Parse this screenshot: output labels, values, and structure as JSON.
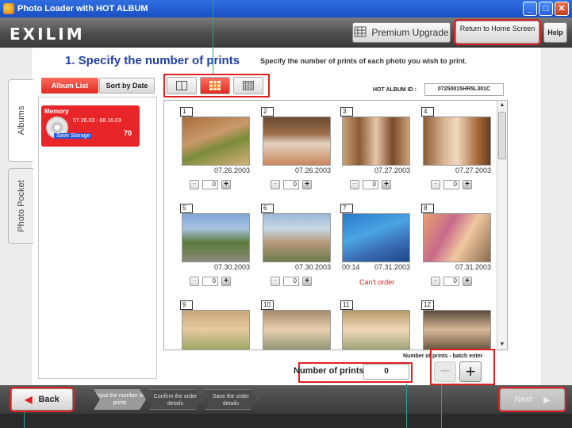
{
  "window": {
    "title": "Photo Loader with HOT ALBUM"
  },
  "header": {
    "logo": "EXILIM",
    "premium_label": "Premium Upgrade",
    "return_label": "Return to Home Screen",
    "help_label": "Help"
  },
  "step": {
    "title": "1. Specify the number of prints",
    "description": "Specify the number of prints of each photo you wish to print."
  },
  "sidetabs": [
    "Albums",
    "Photo Pocket"
  ],
  "album_controls": {
    "album_list": "Album List",
    "sort_by_date": "Sort by Date"
  },
  "album": {
    "name": "Memory",
    "dates": "07.26.03 - 08.16.03",
    "count": "70",
    "tag": "Save Storage"
  },
  "album_id": {
    "label": "HOT ALBUM ID :",
    "value": "07250015HR5L301C"
  },
  "photos": [
    {
      "num": "1",
      "date": "07.26.2003",
      "count": "0"
    },
    {
      "num": "2",
      "date": "07.26.2003",
      "count": "0"
    },
    {
      "num": "3",
      "date": "07.27.2003",
      "count": "0"
    },
    {
      "num": "4",
      "date": "07.27.2003",
      "count": "0"
    },
    {
      "num": "5",
      "date": "07.30.2003",
      "count": "0"
    },
    {
      "num": "6",
      "date": "07.30.2003",
      "count": "0"
    },
    {
      "num": "7",
      "date": "07.31.2003",
      "duration": "00:14",
      "note": "Can't order"
    },
    {
      "num": "8",
      "date": "07.31.2003",
      "count": "0"
    },
    {
      "num": "9"
    },
    {
      "num": "10"
    },
    {
      "num": "11"
    },
    {
      "num": "12"
    }
  ],
  "batch": {
    "label": "Number of prints - batch enter",
    "minus": "−",
    "plus": "+"
  },
  "number_of_prints": {
    "label": "Number of prints :",
    "value": "0"
  },
  "nav": {
    "back": "Back",
    "next": "Next",
    "steps": [
      "Input the number of prints",
      "Confirm the order details",
      "Save the order details"
    ]
  },
  "colors": {
    "accent": "#e02020",
    "title_blue": "#1f3fa8",
    "highlight_box": "#e02020"
  }
}
